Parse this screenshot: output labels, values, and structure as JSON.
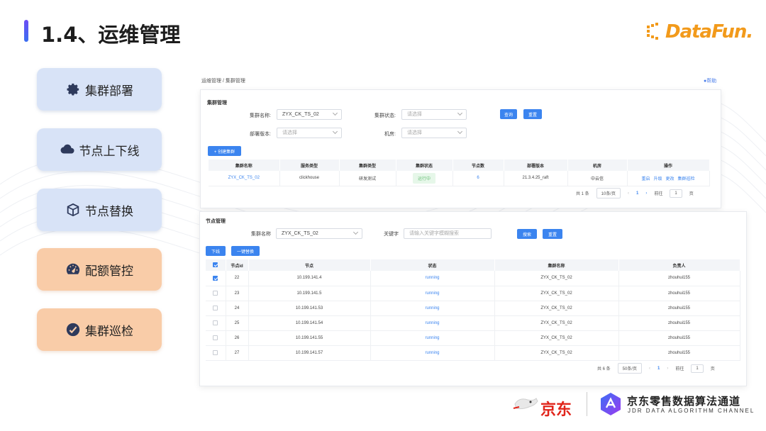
{
  "slide": {
    "title": "1.4、运维管理",
    "logo_text": "DataFun."
  },
  "nav": [
    {
      "label": "集群部署",
      "icon": "gear-icon",
      "theme": "blue"
    },
    {
      "label": "节点上下线",
      "icon": "cloud-icon",
      "theme": "blue"
    },
    {
      "label": "节点替换",
      "icon": "cube-icon",
      "theme": "blue"
    },
    {
      "label": "配额管控",
      "icon": "gauge-icon",
      "theme": "orange"
    },
    {
      "label": "集群巡检",
      "icon": "check-circle-icon",
      "theme": "orange"
    }
  ],
  "cluster_page": {
    "breadcrumb": "运维管理 / 集群管理",
    "help": "帮助",
    "section": "集群管理",
    "filters": {
      "name_label": "集群名称:",
      "name_value": "ZYX_CK_TS_02",
      "status_label": "集群状态:",
      "status_placeholder": "请选择",
      "version_label": "部署版本:",
      "version_placeholder": "请选择",
      "room_label": "机房:",
      "room_placeholder": "请选择"
    },
    "query_button": "查询",
    "reset_button": "重置",
    "create_button": "+ 创建集群",
    "columns": [
      "集群名称",
      "服务类型",
      "集群类型",
      "集群状态",
      "节点数",
      "部署版本",
      "机房",
      "操作"
    ],
    "rows": [
      {
        "name": "ZYX_CK_TS_02",
        "service": "clickhouse",
        "type": "研发测试",
        "status": "运行中",
        "nodes": "6",
        "version": "21.3.4.25_raft",
        "room": "中云信",
        "ops": [
          "重启",
          "升级",
          "更改",
          "集群巡检"
        ]
      }
    ],
    "pager": {
      "total": "共 1 条",
      "page_size": "10条/页",
      "current": "1",
      "goto_label": "前往",
      "goto_value": "1",
      "page_unit": "页"
    }
  },
  "node_page": {
    "section": "节点管理",
    "name_label": "集群名称",
    "name_value": "ZYX_CK_TS_02",
    "keyword_label": "关键字",
    "keyword_placeholder": "请输入关键字模糊搜索",
    "search_button": "搜索",
    "reset_button": "重置",
    "offline_button": "下线",
    "replace_button": "一键替换",
    "columns": [
      "节点id",
      "节点",
      "状态",
      "集群名称",
      "负责人"
    ],
    "rows": [
      {
        "checked": true,
        "id": "22",
        "node": "10.199.141.4",
        "status": "running",
        "cluster": "ZYX_CK_TS_02",
        "owner": "zhouhui155"
      },
      {
        "checked": false,
        "id": "23",
        "node": "10.199.141.5",
        "status": "running",
        "cluster": "ZYX_CK_TS_02",
        "owner": "zhouhui155"
      },
      {
        "checked": false,
        "id": "24",
        "node": "10.199.141.53",
        "status": "running",
        "cluster": "ZYX_CK_TS_02",
        "owner": "zhouhui155"
      },
      {
        "checked": false,
        "id": "25",
        "node": "10.199.141.54",
        "status": "running",
        "cluster": "ZYX_CK_TS_02",
        "owner": "zhouhui155"
      },
      {
        "checked": false,
        "id": "26",
        "node": "10.199.141.55",
        "status": "running",
        "cluster": "ZYX_CK_TS_02",
        "owner": "zhouhui155"
      },
      {
        "checked": false,
        "id": "27",
        "node": "10.199.141.57",
        "status": "running",
        "cluster": "ZYX_CK_TS_02",
        "owner": "zhouhui155"
      }
    ],
    "pager": {
      "total": "共 6 条",
      "page_size": "50条/页",
      "current": "1",
      "goto_label": "前往",
      "goto_value": "1",
      "page_unit": "页"
    }
  },
  "footer": {
    "jd": "京东",
    "channel_cn": "京东零售数据算法通道",
    "channel_en": "JDR DATA ALGORITHM CHANNEL"
  },
  "colors": {
    "accent": "#3b84ef",
    "brand_orange": "#f29a1b",
    "jd_red": "#e1251b",
    "nav_blue": "#d8e3f7",
    "nav_orange": "#f9cca8"
  }
}
